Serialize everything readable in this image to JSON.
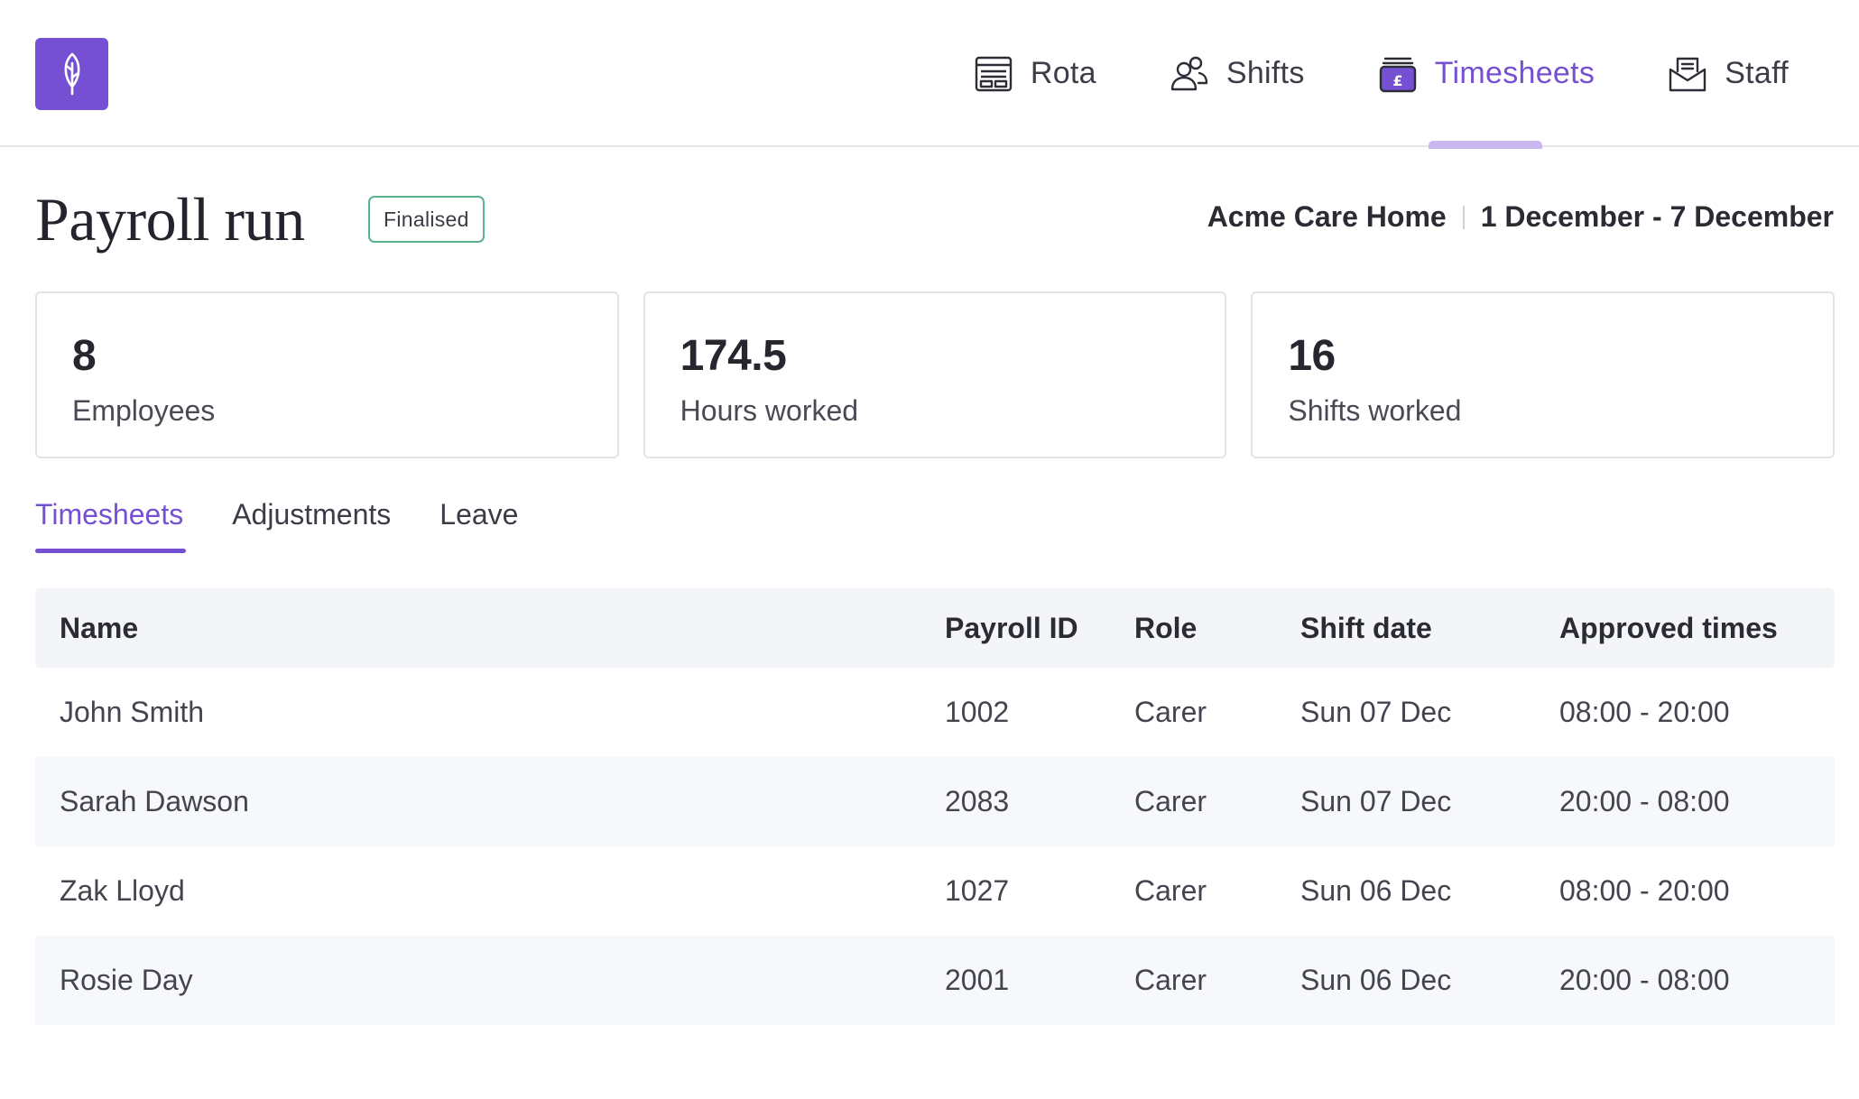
{
  "nav": {
    "items": [
      {
        "label": "Rota",
        "icon": "rota-icon",
        "active": false
      },
      {
        "label": "Shifts",
        "icon": "shifts-icon",
        "active": false
      },
      {
        "label": "Timesheets",
        "icon": "timesheets-icon",
        "active": true
      },
      {
        "label": "Staff",
        "icon": "staff-icon",
        "active": false
      }
    ]
  },
  "page": {
    "title": "Payroll run",
    "status": "Finalised",
    "location": "Acme Care Home",
    "date_range": "1 December - 7 December"
  },
  "stats": [
    {
      "value": "8",
      "label": "Employees"
    },
    {
      "value": "174.5",
      "label": "Hours worked"
    },
    {
      "value": "16",
      "label": "Shifts worked"
    }
  ],
  "tabs": [
    {
      "label": "Timesheets",
      "active": true
    },
    {
      "label": "Adjustments",
      "active": false
    },
    {
      "label": "Leave",
      "active": false
    }
  ],
  "table": {
    "columns": [
      "Name",
      "Payroll ID",
      "Role",
      "Shift date",
      "Approved times"
    ],
    "rows": [
      {
        "name": "John Smith",
        "payroll_id": "1002",
        "role": "Carer",
        "shift_date": "Sun 07 Dec",
        "approved_times": "08:00 - 20:00"
      },
      {
        "name": "Sarah Dawson",
        "payroll_id": "2083",
        "role": "Carer",
        "shift_date": "Sun 07 Dec",
        "approved_times": "20:00 - 08:00"
      },
      {
        "name": "Zak Lloyd",
        "payroll_id": "1027",
        "role": "Carer",
        "shift_date": "Sun 06 Dec",
        "approved_times": "08:00 - 20:00"
      },
      {
        "name": "Rosie Day",
        "payroll_id": "2001",
        "role": "Carer",
        "shift_date": "Sun 06 Dec",
        "approved_times": "20:00 - 08:00"
      }
    ]
  },
  "colors": {
    "brand": "#7650d3",
    "badge_border": "#5ab38d",
    "tab_indicator": "#c7b9ee"
  },
  "logo_icon": "feather-icon"
}
